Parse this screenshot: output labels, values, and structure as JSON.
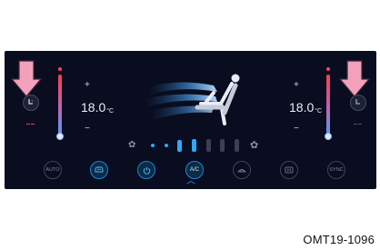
{
  "panel": {
    "left_zone": {
      "plus": "+",
      "minus": "−",
      "temp_value": "18.0",
      "temp_unit": "°C"
    },
    "right_zone": {
      "plus": "+",
      "minus": "−",
      "temp_value": "18.0",
      "temp_unit": "°C"
    },
    "fan": {
      "level": 3,
      "max_level": 8
    },
    "buttons": [
      {
        "name": "auto-button",
        "label": "AUTO",
        "active": false
      },
      {
        "name": "recirculation-button",
        "label": "",
        "icon": "recirculation-icon",
        "active": true
      },
      {
        "name": "power-button",
        "label": "",
        "icon": "power-icon",
        "active": true
      },
      {
        "name": "ac-button",
        "label": "A/C",
        "active": true
      },
      {
        "name": "front-defrost-button",
        "label": "",
        "icon": "front-defrost-icon",
        "active": false
      },
      {
        "name": "rear-defrost-button",
        "label": "",
        "icon": "rear-defrost-icon",
        "active": false
      },
      {
        "name": "sync-button",
        "label": "SYNC",
        "active": false
      }
    ],
    "expand_chevron": "︿"
  },
  "caption": "OMT19-1096",
  "colors": {
    "accent": "#2fa8ff",
    "arrow": "#f3a0bd",
    "panel_bg": "#0a0d1f"
  }
}
